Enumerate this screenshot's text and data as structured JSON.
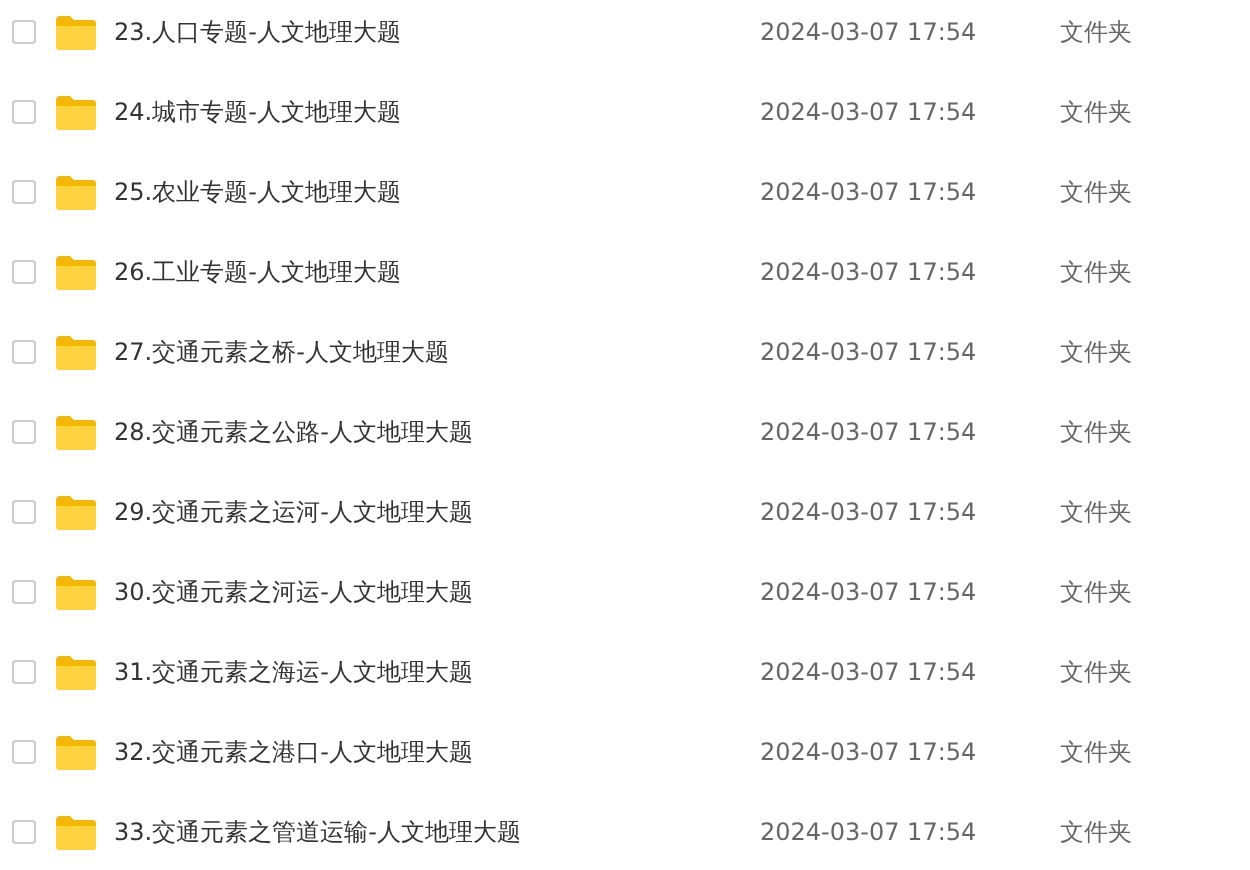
{
  "files": [
    {
      "name": "23.人口专题-人文地理大题",
      "date": "2024-03-07 17:54",
      "type": "文件夹",
      "checked": false
    },
    {
      "name": "24.城市专题-人文地理大题",
      "date": "2024-03-07 17:54",
      "type": "文件夹",
      "checked": false
    },
    {
      "name": "25.农业专题-人文地理大题",
      "date": "2024-03-07 17:54",
      "type": "文件夹",
      "checked": false
    },
    {
      "name": "26.工业专题-人文地理大题",
      "date": "2024-03-07 17:54",
      "type": "文件夹",
      "checked": false
    },
    {
      "name": "27.交通元素之桥-人文地理大题",
      "date": "2024-03-07 17:54",
      "type": "文件夹",
      "checked": false
    },
    {
      "name": "28.交通元素之公路-人文地理大题",
      "date": "2024-03-07 17:54",
      "type": "文件夹",
      "checked": false
    },
    {
      "name": "29.交通元素之运河-人文地理大题",
      "date": "2024-03-07 17:54",
      "type": "文件夹",
      "checked": false
    },
    {
      "name": "30.交通元素之河运-人文地理大题",
      "date": "2024-03-07 17:54",
      "type": "文件夹",
      "checked": false
    },
    {
      "name": "31.交通元素之海运-人文地理大题",
      "date": "2024-03-07 17:54",
      "type": "文件夹",
      "checked": false
    },
    {
      "name": "32.交通元素之港口-人文地理大题",
      "date": "2024-03-07 17:54",
      "type": "文件夹",
      "checked": false
    },
    {
      "name": "33.交通元素之管道运输-人文地理大题",
      "date": "2024-03-07 17:54",
      "type": "文件夹",
      "checked": false
    }
  ]
}
